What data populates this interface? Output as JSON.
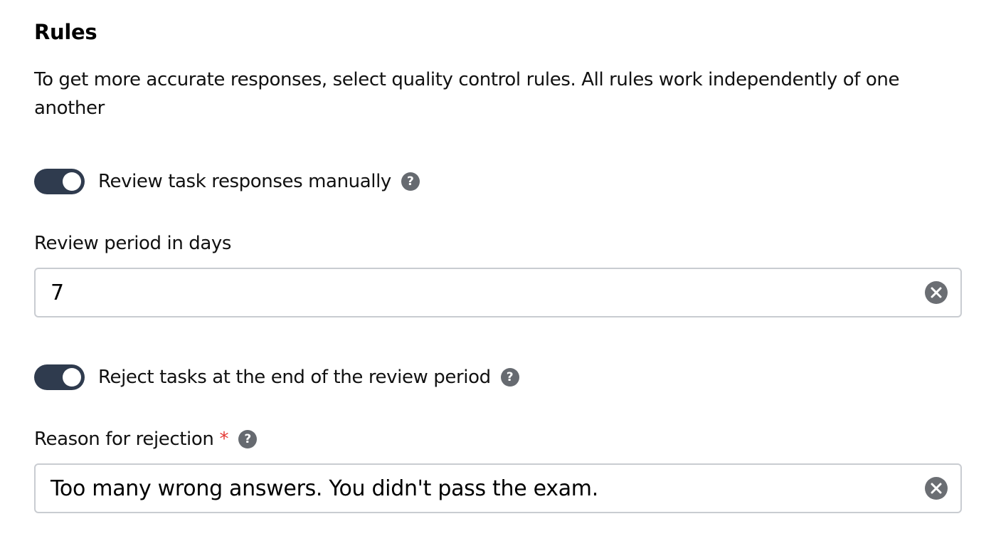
{
  "section": {
    "title": "Rules",
    "description": "To get more accurate responses, select quality control rules. All rules work independently of one another"
  },
  "manual_review": {
    "label": "Review task responses manually",
    "enabled": true,
    "help_icon": "?"
  },
  "review_period": {
    "label": "Review period in days",
    "value": "7"
  },
  "reject_at_end": {
    "label": "Reject tasks at the end of the review period",
    "enabled": true,
    "help_icon": "?"
  },
  "rejection_reason": {
    "label": "Reason for rejection",
    "required_mark": "*",
    "help_icon": "?",
    "value": "Too many wrong answers. You didn't pass the exam."
  },
  "colors": {
    "toggle_on": "#2f3b4e",
    "required": "#e53935",
    "icon": "#666a70",
    "input_border": "#c9ccd1"
  },
  "icons": {
    "help": "question-circle-icon",
    "clear": "clear-x-circle-icon"
  }
}
